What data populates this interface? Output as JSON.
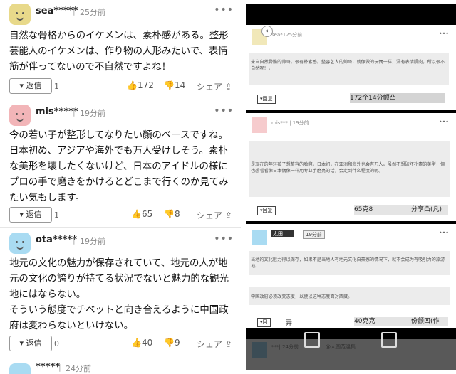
{
  "left": {
    "comments": [
      {
        "user": "sea*****",
        "time": "25分前",
        "body": "自然な骨格からのイケメンは、素朴感がある。整形\n芸能人のイケメンは、作り物の人形みたいで、表情\n筋が伴ってないので不自然ですよね！",
        "reply_label": "返信",
        "reply_count": "1",
        "likes": "172",
        "dislikes": "14",
        "share": "シェア",
        "avatar_color": "#e8d98a"
      },
      {
        "user": "mis*****",
        "time": "19分前",
        "body": "今の若い子が整形してなりたい顔のベースですね。\n日本初め、アジアや海外でも万人受けしそう。素朴\nな美形を壊したくないけど、日本のアイドルの様に\nプロの手で磨きをかけるとどこまで行くのか見てみ\nたい気もします。",
        "reply_label": "返信",
        "reply_count": "1",
        "likes": "65",
        "dislikes": "8",
        "share": "シェア",
        "avatar_color": "#f2b5b8"
      },
      {
        "user": "ota*****",
        "time": "19分前",
        "body": "地元の文化の魅力が保存されていて、地元の人が地\n元の文化の誇りが持てる状況でないと魅力的な観光\n地にはならない。\nそういう態度でチベットと向き合えるように中国政\n府は変わらないといけない。",
        "reply_label": "返信",
        "reply_count": "0",
        "likes": "40",
        "dislikes": "9",
        "share": "シェア",
        "avatar_color": "#a9dbf2"
      },
      {
        "user": "*****",
        "time": "24分前",
        "avatar_color": "#a9dbf2"
      }
    ]
  },
  "right": {
    "c1": {
      "user": "sea*125分前",
      "text": "来自自然骨骼的帅哥，很有朴素感。整容艺人的帅哥，就像做的玩偶一样，没有表情肌肉，所以很不自然呢！。",
      "reply": "▾回复",
      "stats": "172个14分颤凸"
    },
    "c2": {
      "user": "mis*** | 19分前",
      "text": "是现在的年轻孩子想整容的脸啊。日本初，在亚洲和海外也会有万人。虽然不想破坏朴素的美型，但也想看看像日本偶像一样用专业手磨亮的话，会走到什么程度的呢。",
      "reply": "▾回复",
      "stats_a": "65克8",
      "stats_b": "分享凸(凡)"
    },
    "c3": {
      "user": "太田",
      "time": "19分前",
      "text_a": "当地的文化魅力得以保存，如果不是当地人有地元文化自豪感的情况下，就不会成为有吸引力的旅游地。",
      "text_b": "中国政府必须改变态度，以便以这种态度面对西藏。",
      "reply": "▾回",
      "reply_tail": "弄",
      "stats_a": "40克克",
      "stats_b": "份颤凹(作"
    },
    "c4": {
      "user": "***| 24分前",
      "name2": "@人圆范温集"
    }
  }
}
